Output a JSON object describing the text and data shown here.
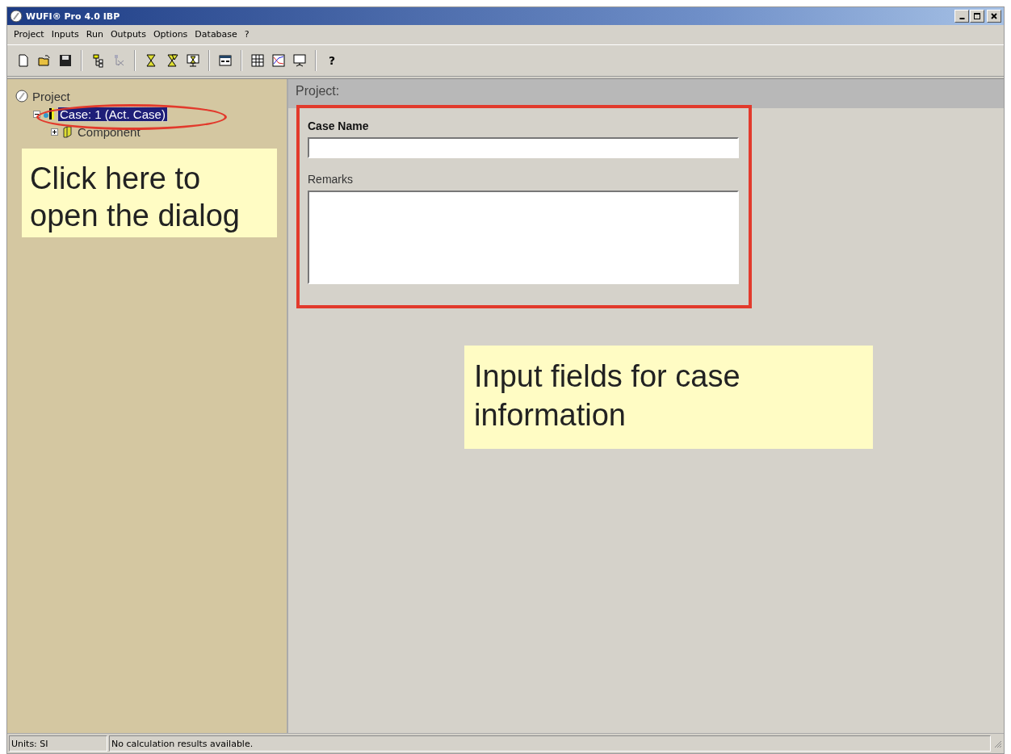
{
  "window": {
    "title": "WUFI® Pro 4.0 IBP"
  },
  "menu": [
    "Project",
    "Inputs",
    "Run",
    "Outputs",
    "Options",
    "Database",
    "?"
  ],
  "toolbar": {
    "help_label": "?"
  },
  "tree": [
    {
      "label": "Project",
      "selected": false,
      "children": [
        {
          "label": "Case: 1  (Act. Case)",
          "expanded": true,
          "selected": true,
          "children": [
            {
              "label": "Component",
              "expanded": false,
              "selected": false
            }
          ]
        }
      ]
    }
  ],
  "panel": {
    "title": "Project:",
    "fields": [
      {
        "label": "Case Name",
        "kind": "line",
        "bold": true
      },
      {
        "label": "Remarks",
        "kind": "area",
        "bold": false
      }
    ]
  },
  "callouts": [
    {
      "text": "Click here to open the dialog"
    },
    {
      "text": "Input fields for case information"
    }
  ],
  "status_bar": [
    "Units: SI",
    "No calculation results available."
  ]
}
